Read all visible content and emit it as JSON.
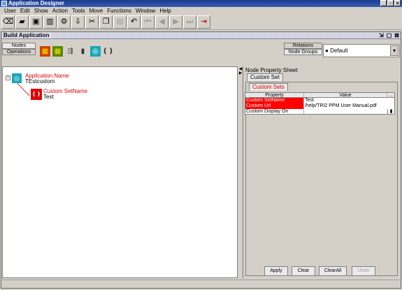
{
  "window": {
    "title": "Application Designer"
  },
  "menu": [
    "User",
    "Edit",
    "Show",
    "Action",
    "Tools",
    "Move",
    "Functions",
    "Window",
    "Help"
  ],
  "toolbar": {
    "icons": [
      "eraser-icon",
      "open-folder-icon",
      "save-icon",
      "trash-icon",
      "wrench-icon",
      "import-icon",
      "cut-icon",
      "copy-icon",
      "paste-icon",
      "undo-icon",
      "first-icon",
      "prev-icon",
      "next-icon",
      "last-icon",
      "exit-icon"
    ]
  },
  "doc": {
    "title": "Build Application"
  },
  "leftTabs": {
    "nodes": "Nodes",
    "operations": "Operations"
  },
  "rightTabs": {
    "relations": "Relations",
    "node_groups": "Node Groups"
  },
  "default_select": "Default",
  "tree": {
    "app_label": "Application Name",
    "app_value": "TEstcustom",
    "set_label": "Custom SetName",
    "set_value": "Test"
  },
  "sheet": {
    "title": "Node Property Sheet",
    "tab": "Custom Set",
    "subtab": "Custom Sets",
    "col_property": "Property",
    "col_value": "Value",
    "ellipsis": "...",
    "rows": [
      {
        "property": "Custom SetName",
        "value": "Test"
      },
      {
        "property": "Custom Url",
        "value": "/help/TRI2 PPM User Manual.pdf"
      },
      {
        "property": "Custom Display On",
        "value": ""
      }
    ]
  },
  "buttons": {
    "apply": "Apply",
    "clear": "Clear",
    "clearall": "ClearAll",
    "undo": "Undo"
  },
  "colors": {
    "highlight": "#ff0000",
    "title_bar": "#1a3c8c",
    "node_icon": "#1aa6b8"
  }
}
